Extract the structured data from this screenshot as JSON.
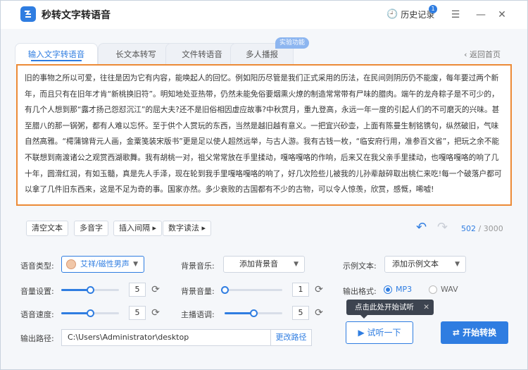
{
  "app": {
    "title": "秒转文字转语音"
  },
  "titlebar": {
    "history_label": "历史记录",
    "history_badge": "1",
    "menu": "☰",
    "minimize": "—",
    "close": "✕"
  },
  "tabs": [
    {
      "label": "输入文字转语音"
    },
    {
      "label": "长文本转写"
    },
    {
      "label": "文件转语音"
    },
    {
      "label": "多人播报"
    }
  ],
  "tabs_extra": {
    "experimental_tag": "实验功能",
    "back_label": "返回首页"
  },
  "editor": {
    "text": "旧的事物之所以可爱，往往是因为它有内容，能唤起人的回忆。例如阳历尽管是我们正式采用的历法，在民间则阴历仍不能废，每年要过两个新年，而且只有在旧年才肯“新桃换旧符”。明知地处亚热带，仍然未能免俗要烟熏火燎的制造常常带有尸味的腊肉。端午的龙舟粽子是不可少的，有几个人想到那“露才扬己怨怼沉江”的屈大夫?还不是旧俗相因虚应故事?中秋赏月，重九登高，永远一年一度的引起人们的不可磨灭的兴味。甚至腊八的那一锅粥，都有人难以忘怀。至于供个人赏玩的东西，当然是越旧越有意义。一把宜兴砂壶，上面有陈曼生制铭镌句，纵然破旧，气味自然高雅。“樗蒲锦背元人画，金粟笺装宋版书”更是足以使人超然远举，与古人游。我有古钱一枚，“临安府行用，准参百文省”，把玩之余不能不联想到南渡诸公之观赏西湖歌舞。我有胡桃一对，祖父常常放在手里揉动，嘎咯嘎咯的作响，后来又在我父亲手里揉动，也嘎咯嘎咯的响了几十年，圆滑红润，有如玉髓，真是先人手泽，现在轮到我手里嘎咯嘎咯的响了，好几次险些儿被我的儿孙辈敲碎取出桃仁来吃!每一个破落户都可以拿了几件旧东西来，这是不足为奇的事。国家亦然。多少衰败的古国都有不少的古物，可以令人惊羡，欣赏，感慨，唏嘘!"
  },
  "toolbar": {
    "clear": "清空文本",
    "polyphone": "多音字",
    "insert_pause": "插入间隔 ▸",
    "digit_read": "数字读法 ▸",
    "char_count": "502",
    "char_sep": " / ",
    "char_max": "3000"
  },
  "settings": {
    "voice_type_label": "语音类型:",
    "voice_value": "艾祥/磁性男声",
    "bgm_label": "背景音乐:",
    "bgm_value": "添加背景音",
    "sample_label": "示例文本:",
    "sample_value": "添加示例文本",
    "volume_label": "音量设置:",
    "volume_value": "5",
    "volume_level": 0.5,
    "bgm_volume_label": "背景音量:",
    "bgm_volume_value": "1",
    "bgm_volume_level": 0.0,
    "speed_label": "语音速度:",
    "speed_value": "5",
    "speed_level": 0.5,
    "pitch_label": "主播语调:",
    "pitch_value": "5",
    "pitch_level": 0.5,
    "format_label": "输出格式:",
    "format_mp3": "MP3",
    "format_wav": "WAV",
    "format_selected": "MP3",
    "path_label": "输出路径:",
    "path_value": "C:\\Users\\Administrator\\desktop",
    "change_path": "更改路径"
  },
  "actions": {
    "tooltip": "点击此处开始试听",
    "tooltip_close": "✕",
    "preview": "试听一下",
    "start": "开始转换"
  },
  "colors": {
    "accent": "#2f7de1",
    "highlight_border": "#ec8a36"
  }
}
